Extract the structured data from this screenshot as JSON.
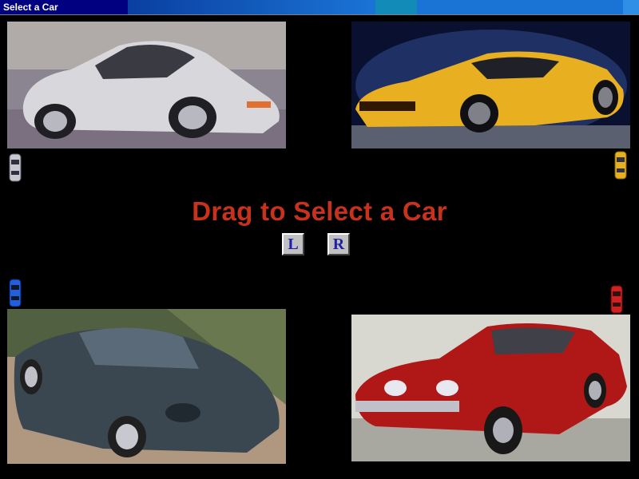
{
  "window": {
    "title": "Select a Car"
  },
  "main": {
    "heading": "Drag to Select a Car",
    "buttons": {
      "left_label": "L",
      "right_label": "R"
    }
  },
  "cars": [
    {
      "position": "top-left",
      "color": "#c8c8d0",
      "icon": "car-top-view-icon"
    },
    {
      "position": "top-right",
      "color": "#e8b020",
      "icon": "car-top-view-icon"
    },
    {
      "position": "bottom-left",
      "color": "#2060e0",
      "icon": "car-top-view-icon"
    },
    {
      "position": "bottom-right",
      "color": "#d02020",
      "icon": "car-top-view-icon"
    }
  ]
}
